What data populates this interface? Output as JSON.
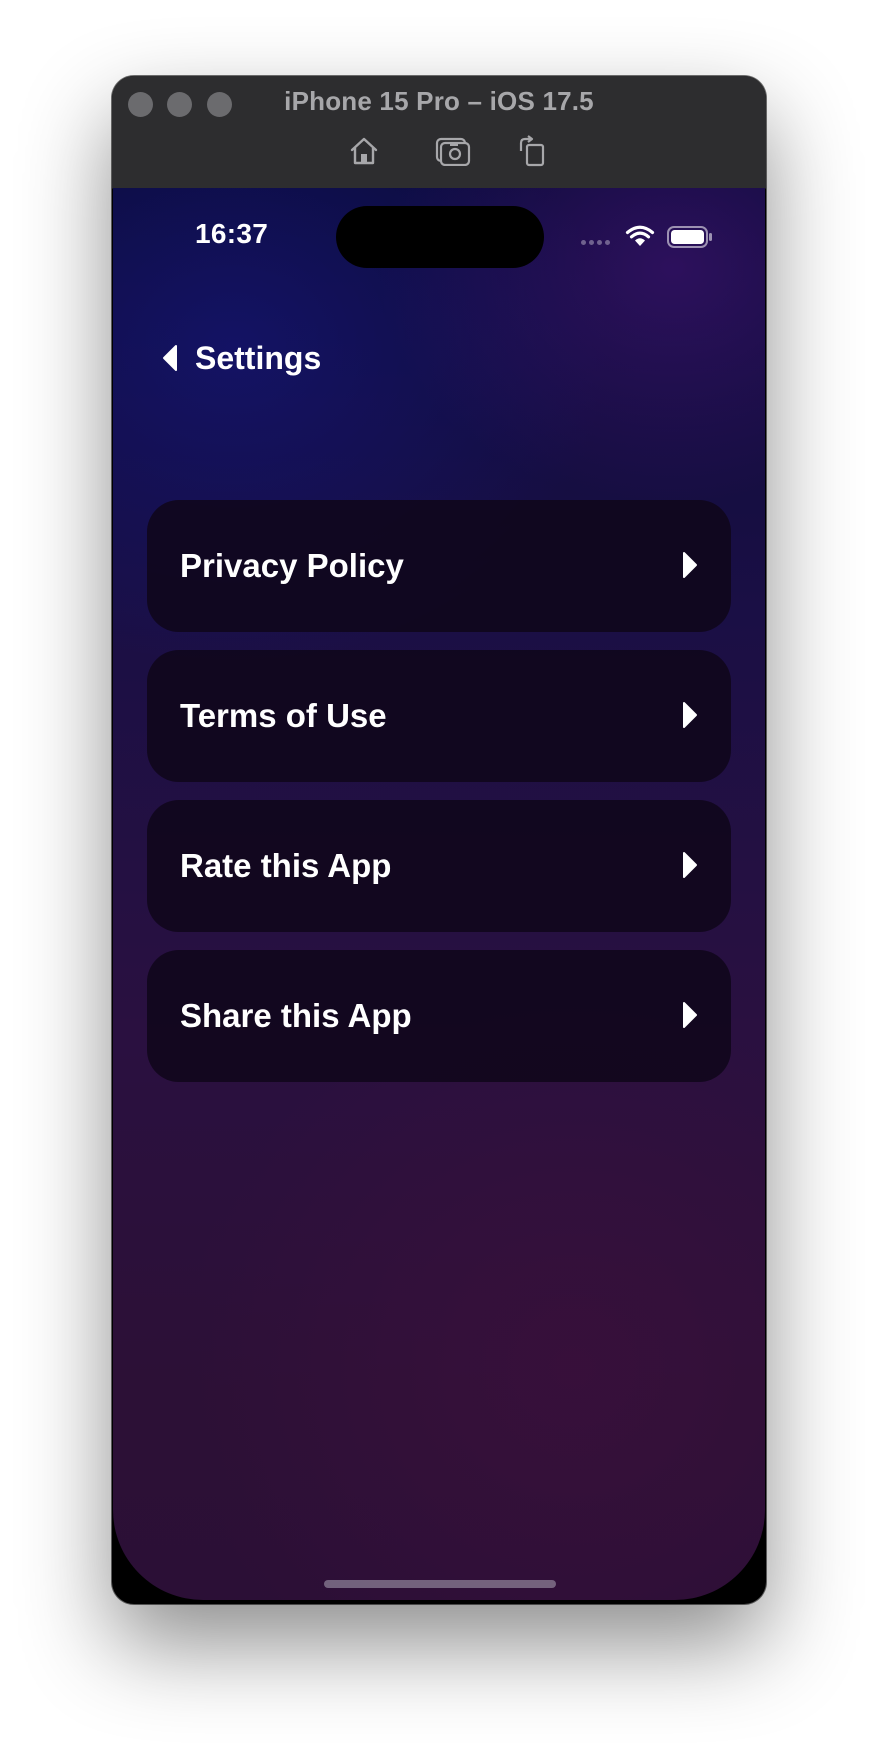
{
  "window": {
    "title": "iPhone 15 Pro – iOS 17.5",
    "toolbar_icons": [
      "home-icon",
      "screenshot-icon",
      "rotate-icon"
    ]
  },
  "status_bar": {
    "time": "16:37",
    "icons": [
      "cellular-signal-icon",
      "wifi-icon",
      "battery-icon"
    ]
  },
  "nav": {
    "back_label": "Settings",
    "back_icon": "back-triangle-icon"
  },
  "menu": {
    "items": [
      {
        "label": "Privacy Policy",
        "icon": "chevron-right-icon"
      },
      {
        "label": "Terms of Use",
        "icon": "chevron-right-icon"
      },
      {
        "label": "Rate this App",
        "icon": "chevron-right-icon"
      },
      {
        "label": "Share this App",
        "icon": "chevron-right-icon"
      }
    ]
  },
  "colors": {
    "row_background": "#0f061a",
    "text": "#ffffff",
    "titlebar": "#2d2d2f"
  }
}
